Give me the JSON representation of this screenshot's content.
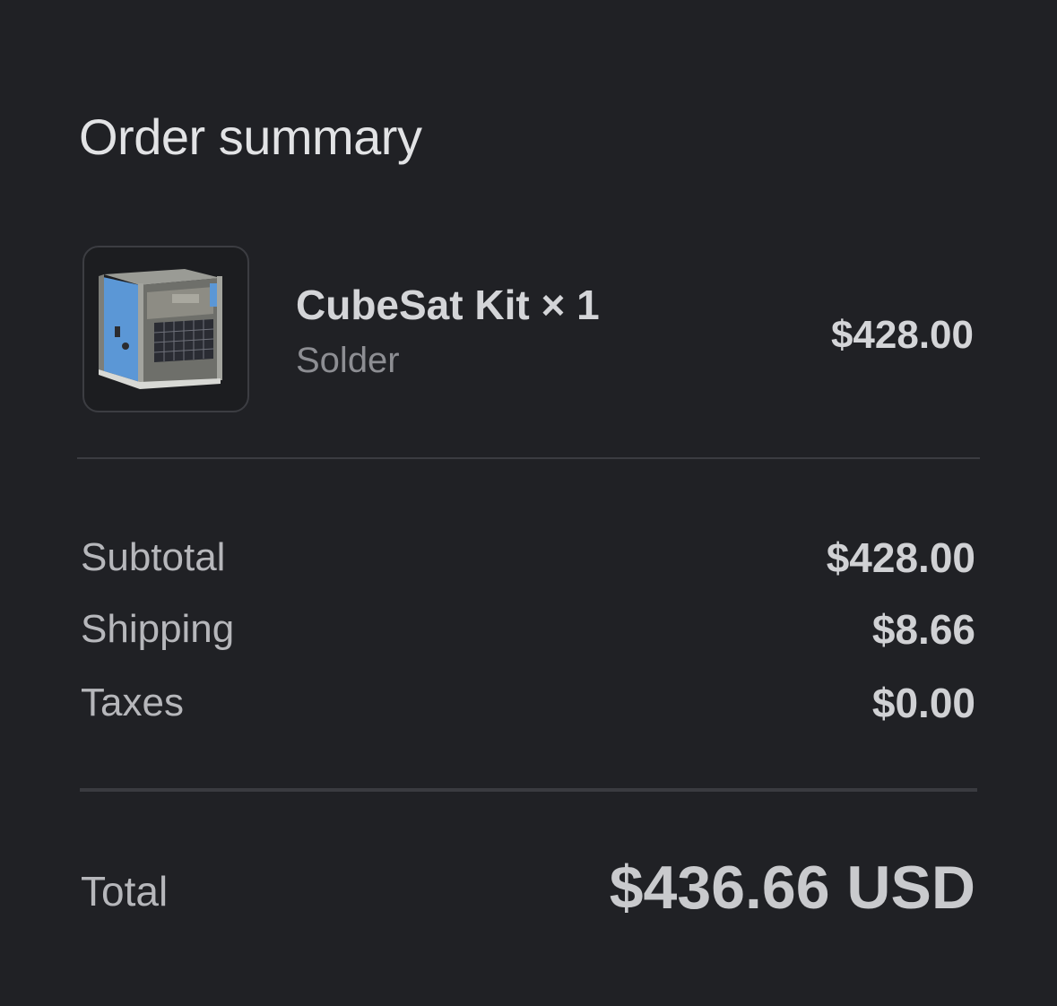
{
  "summary": {
    "title": "Order summary"
  },
  "line_item": {
    "image": "cubesat-kit-product-image",
    "name": "CubeSat Kit × 1",
    "variant": "Solder",
    "price": "$428.00"
  },
  "totals": {
    "subtotal_label": "Subtotal",
    "subtotal_value": "$428.00",
    "shipping_label": "Shipping",
    "shipping_value": "$8.66",
    "taxes_label": "Taxes",
    "taxes_value": "$0.00",
    "total_label": "Total",
    "total_value": "$436.66 USD"
  },
  "colors": {
    "background": "#202125",
    "text_primary": "#d4d5d8",
    "text_secondary": "#8d8e93",
    "divider": "#3b3c41"
  }
}
